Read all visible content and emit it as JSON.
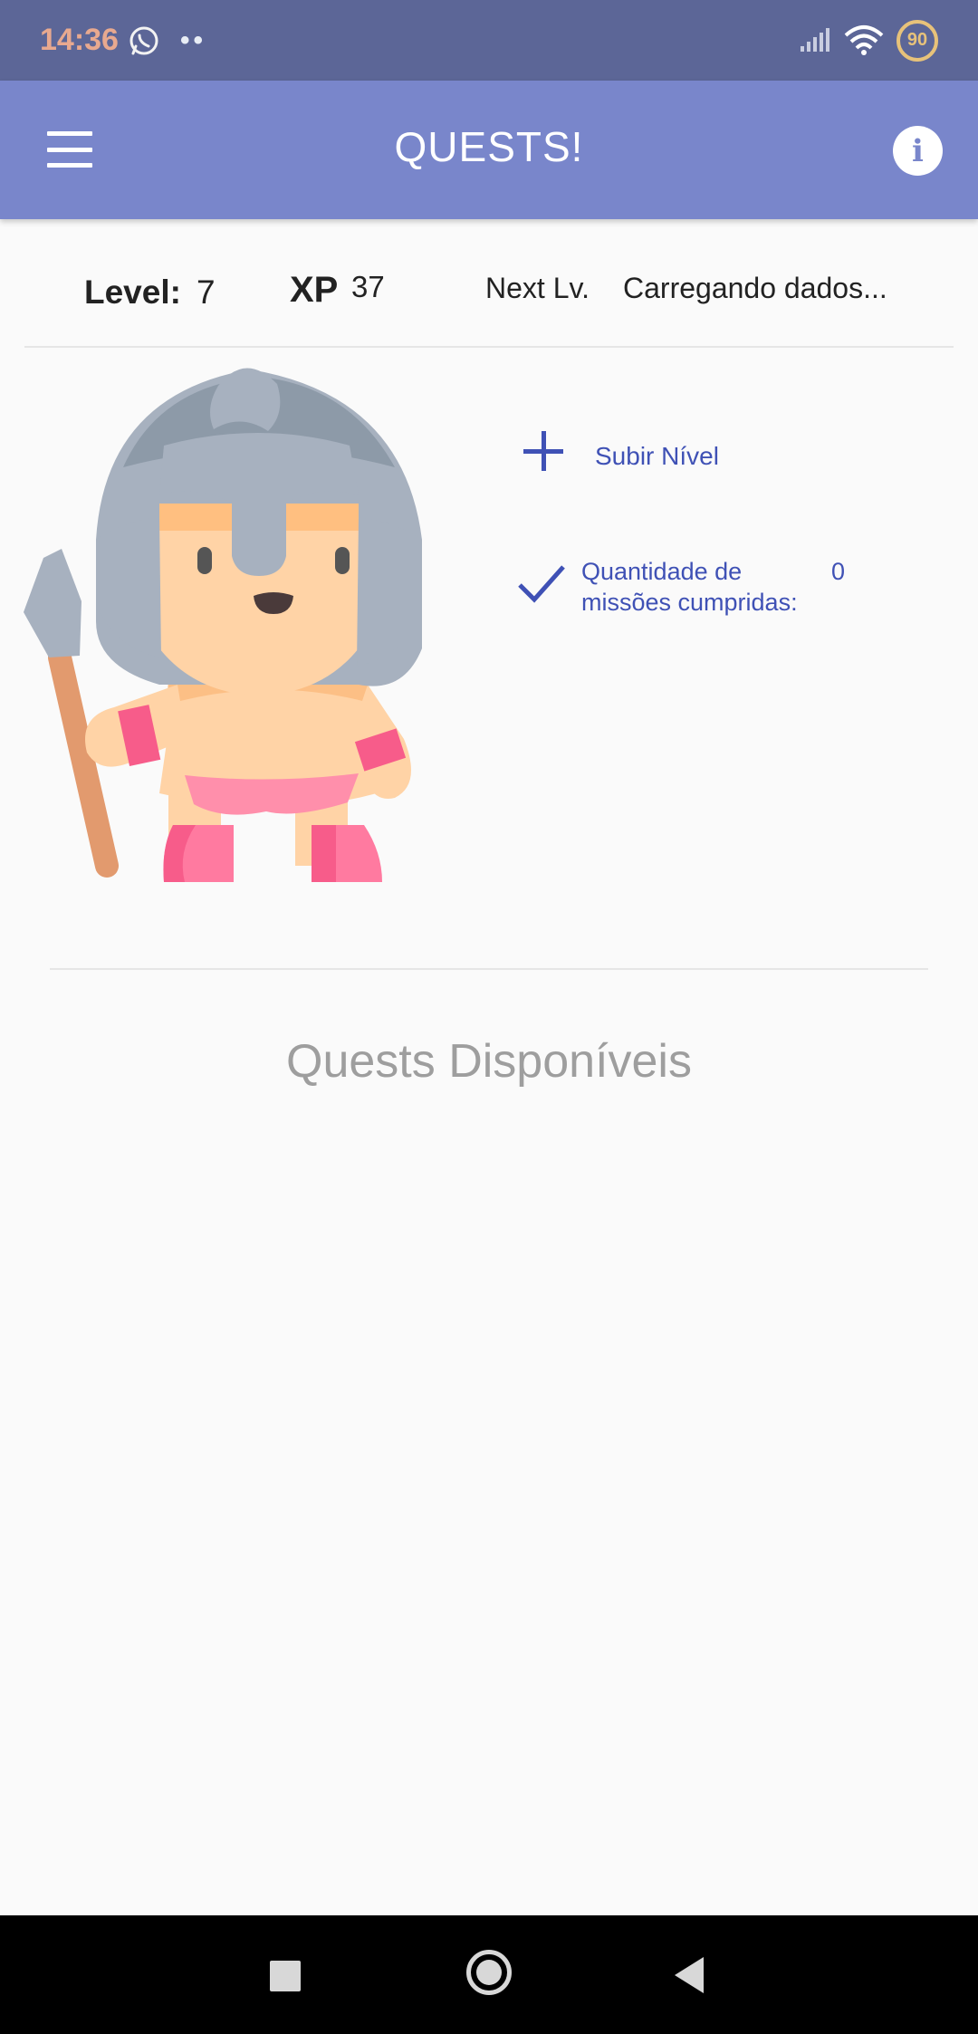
{
  "status_bar": {
    "time": "14:36",
    "dots": "••",
    "battery": "90",
    "icons": [
      "whatsapp-icon",
      "signal-icon",
      "wifi-icon",
      "battery-icon"
    ]
  },
  "app_bar": {
    "title": "QUESTS!",
    "menu_icon": "hamburger-menu-icon",
    "info_icon": "info-icon",
    "info_glyph": "i",
    "color": "#7986cb"
  },
  "stats": {
    "level_label": "Level:",
    "level_value": "7",
    "xp_label": "XP",
    "xp_value": "37",
    "next_label": "Next Lv.",
    "next_value": "Carregando dados..."
  },
  "actions": {
    "level_up_label": "Subir Nível",
    "missions_label": "Quantidade de missões cumpridas:",
    "missions_count": "0",
    "accent": "#3f51b5"
  },
  "quests": {
    "title": "Quests Disponíveis"
  },
  "nav": {
    "icons": [
      "recents-icon",
      "home-icon",
      "back-icon"
    ]
  }
}
